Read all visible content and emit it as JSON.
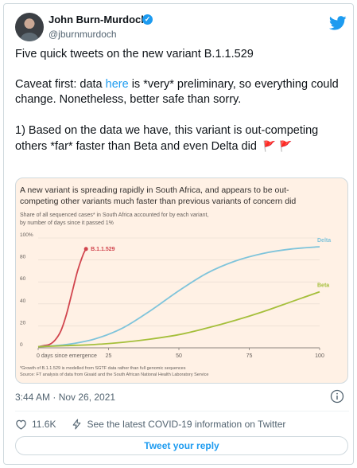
{
  "tweet": {
    "author_name": "John Burn-Murdoch",
    "handle": "@jburnmurdoch",
    "verified_glyph": "✓",
    "line1": "Five quick tweets on the new variant B.1.1.529",
    "line2_pre": "Caveat first: data ",
    "line2_link": "here",
    "line2_post": " is *very* preliminary, so everything could change. Nonetheless, better safe than sorry.",
    "line3": "1) Based on the data we have, this variant is out-competing others *far* faster than Beta and even Delta did",
    "flag_glyph": "🚩",
    "timestamp": "3:44 AM · Nov 26, 2021",
    "like_count": "11.6K",
    "covid_notice": "See the latest COVID-19 information on Twitter",
    "reply_label": "Tweet your reply",
    "colors": {
      "accent": "#1d9bf0",
      "chart_bg": "#fff1e5"
    },
    "icons": [
      "verified-badge-icon",
      "twitter-bird-icon",
      "info-icon",
      "heart-icon",
      "covid-info-icon"
    ]
  },
  "chart_data": {
    "type": "line",
    "title": "A new variant is spreading rapidly in South Africa, and appears to be out-competing other variants much faster than previous variants of concern did",
    "subtitle_line1": "Share of all sequenced cases* in South Africa accounted for by each variant,",
    "subtitle_line2": "by number of days since it passed 1%",
    "xlabel": "",
    "ylabel": "",
    "xlim": [
      0,
      100
    ],
    "ylim": [
      0,
      100
    ],
    "xticks": [
      {
        "value": 0,
        "label": "0 days since emergence"
      },
      {
        "value": 25,
        "label": "25"
      },
      {
        "value": 50,
        "label": "50"
      },
      {
        "value": 75,
        "label": "75"
      },
      {
        "value": 100,
        "label": "100"
      }
    ],
    "yticks": [
      {
        "value": 0,
        "label": "0"
      },
      {
        "value": 20,
        "label": "20"
      },
      {
        "value": 40,
        "label": "40"
      },
      {
        "value": 60,
        "label": "60"
      },
      {
        "value": 80,
        "label": "80"
      },
      {
        "value": 100,
        "label": "100%"
      }
    ],
    "series": [
      {
        "name": "B.1.1.529",
        "color": "#d1454e",
        "x": [
          0,
          2,
          4,
          6,
          8,
          10,
          12,
          14,
          16,
          17
        ],
        "y": [
          1,
          2,
          3,
          7,
          15,
          30,
          50,
          70,
          85,
          90
        ]
      },
      {
        "name": "Delta",
        "color": "#7fc4db",
        "x": [
          0,
          10,
          20,
          30,
          40,
          50,
          60,
          70,
          80,
          90,
          100
        ],
        "y": [
          1,
          3,
          8,
          18,
          34,
          52,
          68,
          79,
          86,
          90,
          92
        ]
      },
      {
        "name": "Beta",
        "color": "#a5bf3b",
        "x": [
          0,
          10,
          20,
          30,
          40,
          50,
          60,
          70,
          80,
          90,
          100
        ],
        "y": [
          1,
          2,
          3,
          5,
          8,
          12,
          18,
          25,
          33,
          42,
          51
        ]
      }
    ],
    "footnote1": "*Growth of B.1.1.529 is modelled from SGTF data rather than full genomic sequences",
    "footnote2": "Source: FT analysis of data from Gisaid and the South African National Health Laboratory Service"
  }
}
